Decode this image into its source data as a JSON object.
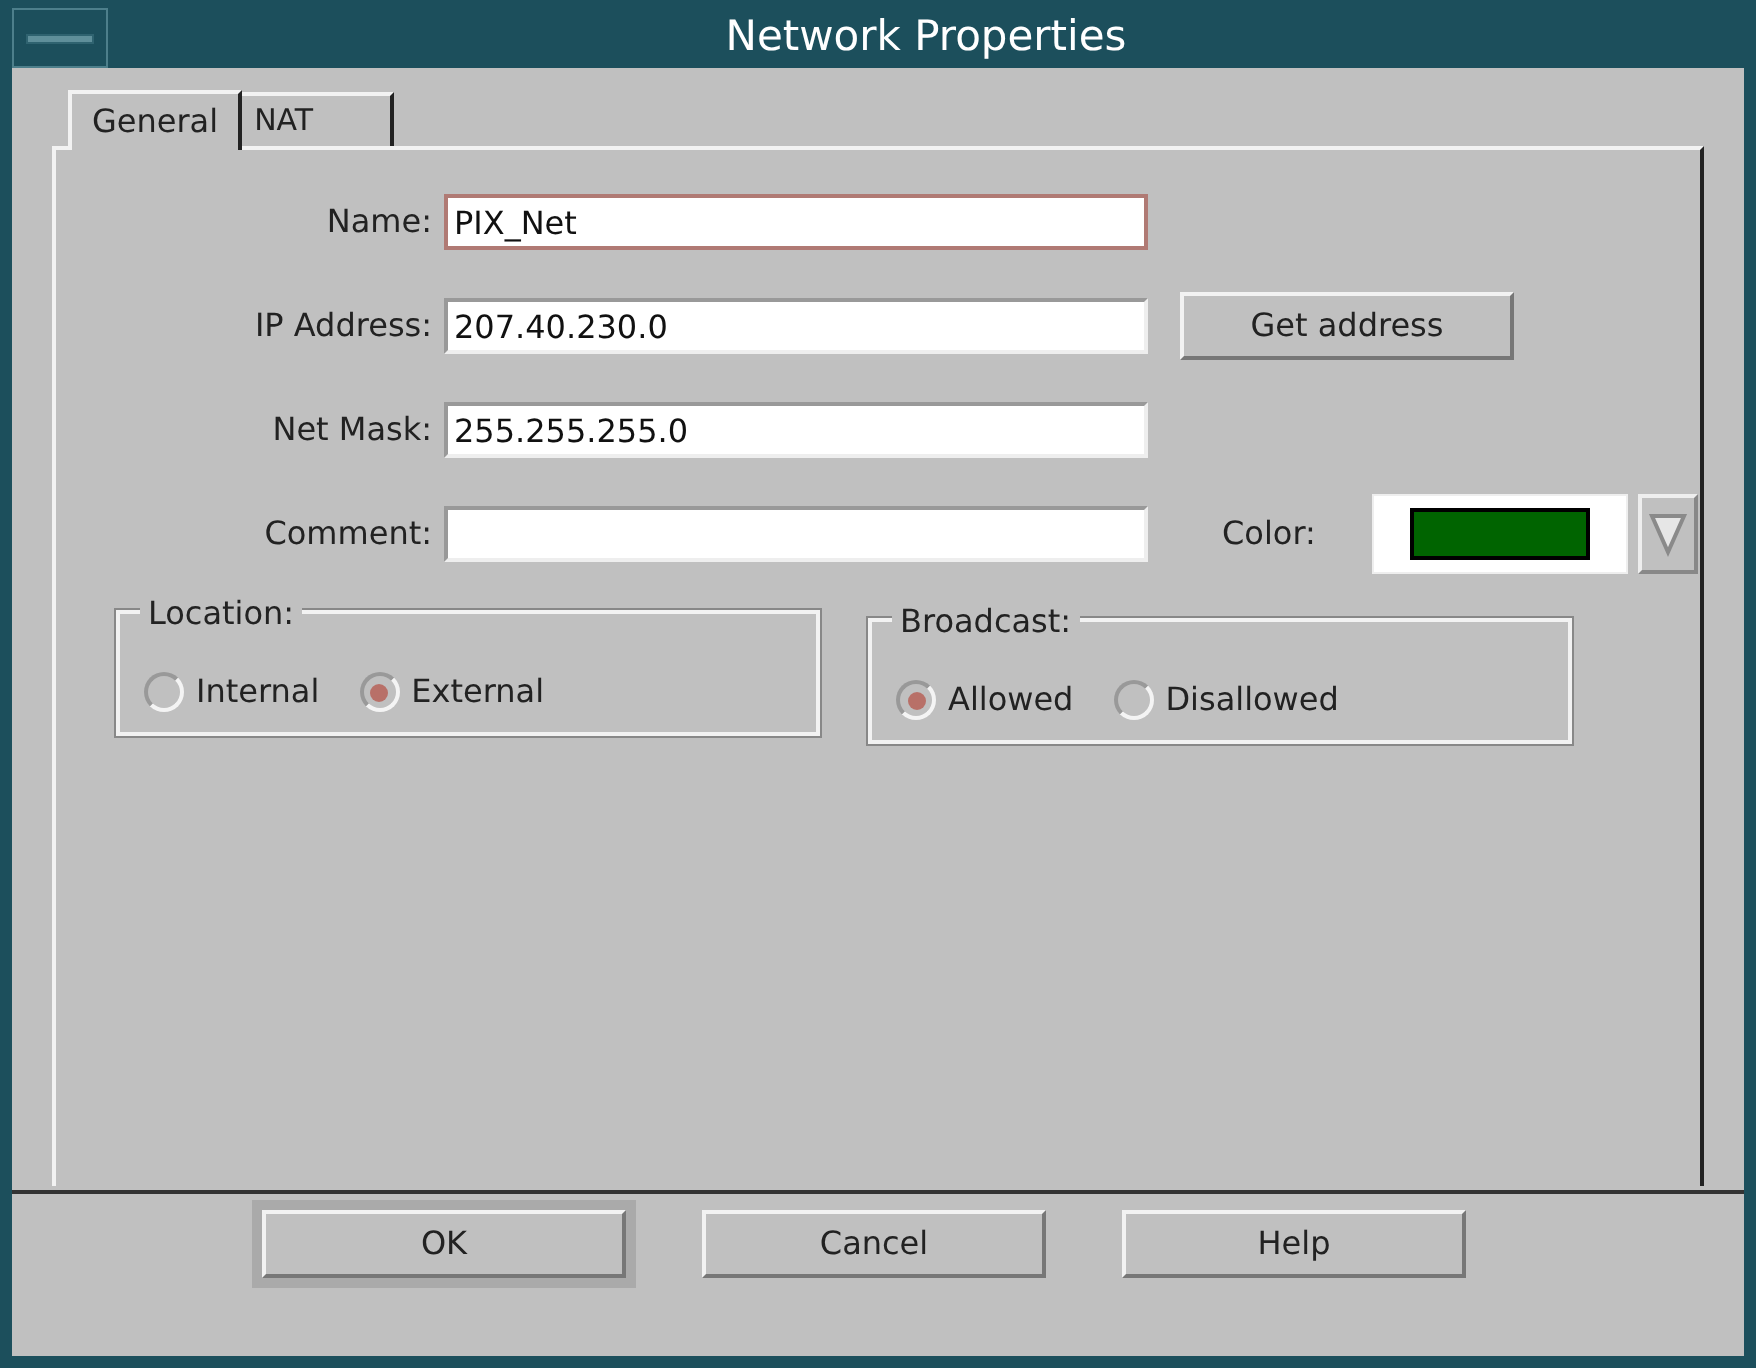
{
  "window": {
    "title": "Network Properties"
  },
  "tabs": [
    {
      "label": "General",
      "selected": true
    },
    {
      "label": "NAT",
      "selected": false
    }
  ],
  "fields": [
    {
      "label": "Name:",
      "value": "PIX_Net",
      "focused": true
    },
    {
      "label": "IP Address:",
      "value": "207.40.230.0",
      "focused": false
    },
    {
      "label": "Net Mask:",
      "value": "255.255.255.0",
      "focused": false
    },
    {
      "label": "Comment:",
      "focused": false
    }
  ],
  "get_address_button": "Get address",
  "color": {
    "label": "Color:",
    "color": "#006400"
  },
  "groups": [
    {
      "title": "Location:",
      "options": [
        {
          "label": "Internal",
          "selected": false
        },
        {
          "label": "External",
          "selected": true
        }
      ]
    },
    {
      "title": "Broadcast:",
      "options": [
        {
          "label": "Allowed",
          "selected": true
        },
        {
          "label": "Disallowed",
          "selected": false
        }
      ]
    }
  ],
  "buttons": [
    {
      "label": "OK",
      "default": true
    },
    {
      "label": "Cancel",
      "default": false
    },
    {
      "label": "Help",
      "default": false
    }
  ]
}
